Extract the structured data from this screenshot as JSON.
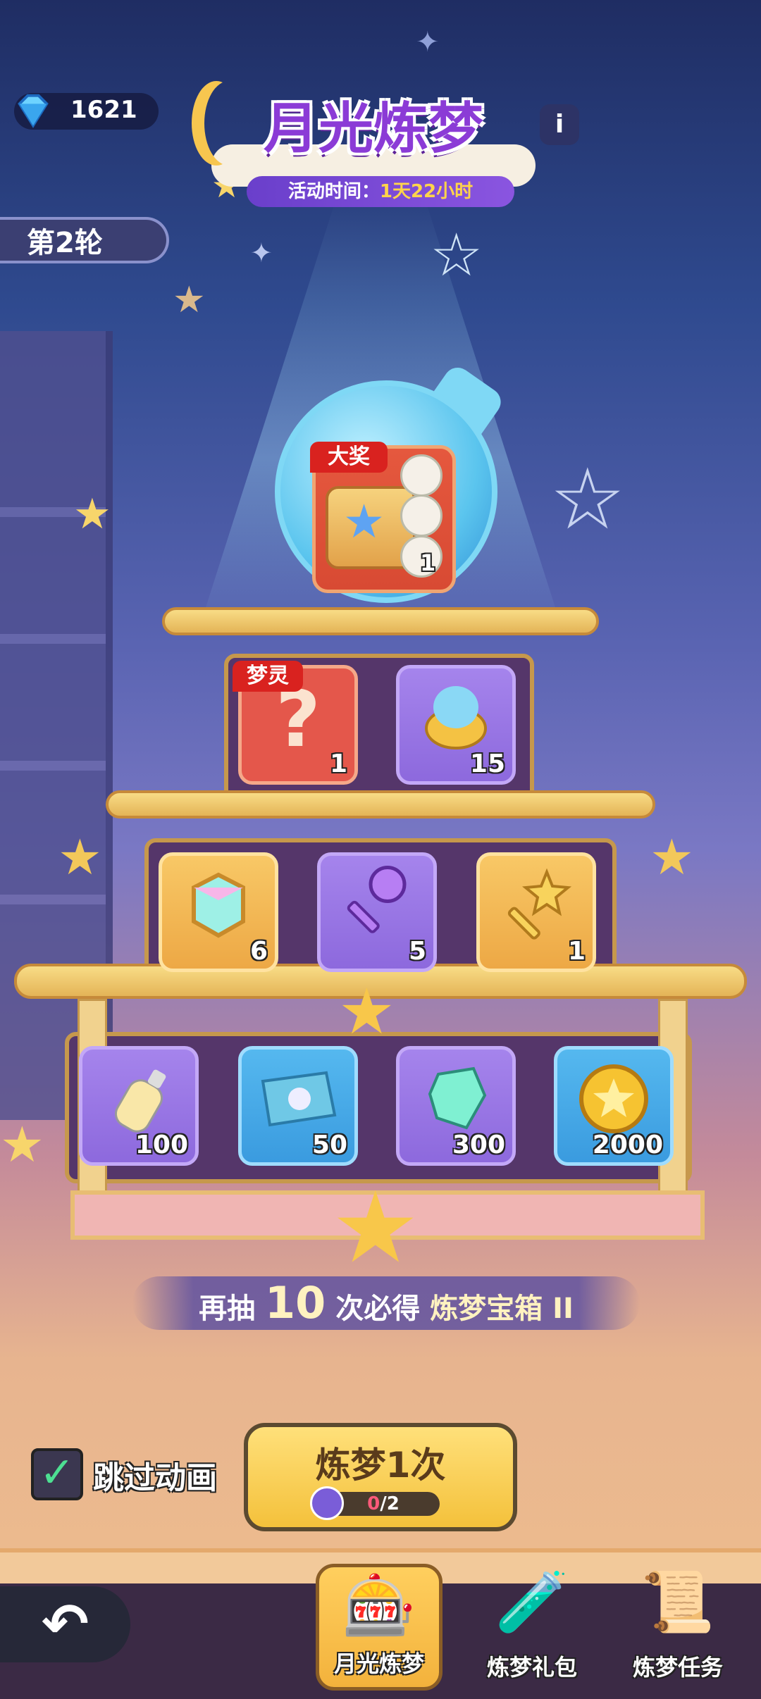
{
  "currency": {
    "icon": "diamond-icon",
    "amount": "1621"
  },
  "header": {
    "title": "月光炼梦",
    "event_time_label": "活动时间：",
    "event_time_value": "1天22小时",
    "info_icon": "info-icon"
  },
  "round": {
    "label": "第2轮"
  },
  "grand_prize": {
    "tag": "大奖",
    "quantity": "1",
    "icon": "star-chest-icon"
  },
  "tier1": [
    {
      "tag": "梦灵",
      "icon": "mystery-question-icon",
      "quantity": "1"
    },
    {
      "icon": "spirit-lantern-icon",
      "quantity": "15"
    }
  ],
  "tier2": [
    {
      "icon": "rainbow-cube-icon",
      "quantity": "6"
    },
    {
      "icon": "purple-key-icon",
      "quantity": "5"
    },
    {
      "icon": "star-key-icon",
      "quantity": "1"
    }
  ],
  "tier3": [
    {
      "icon": "rainbow-bottle-icon",
      "quantity": "100"
    },
    {
      "icon": "blueprint-map-icon",
      "quantity": "50"
    },
    {
      "icon": "crystal-ore-icon",
      "quantity": "300"
    },
    {
      "icon": "gold-coin-icon",
      "quantity": "2000"
    }
  ],
  "banner": {
    "prefix": "再抽",
    "count": "10",
    "middle": "次必得",
    "reward": "炼梦宝箱 II"
  },
  "controls": {
    "skip_label": "跳过动画",
    "skip_checked": true,
    "draw_label": "炼梦1次",
    "draw_cost_used": "0",
    "draw_cost_total": "/2"
  },
  "nav": {
    "back_icon": "back-arrow-icon",
    "items": [
      {
        "label": "月光炼梦",
        "icon": "slot-machine-icon",
        "active": true
      },
      {
        "label": "炼梦礼包",
        "icon": "potion-gift-icon",
        "active": false
      },
      {
        "label": "炼梦任务",
        "icon": "scroll-task-icon",
        "active": false
      }
    ]
  },
  "colors": {
    "title": "#8b3bd6",
    "accent_gold": "#f4c13b",
    "tag_red": "#d9221f"
  }
}
